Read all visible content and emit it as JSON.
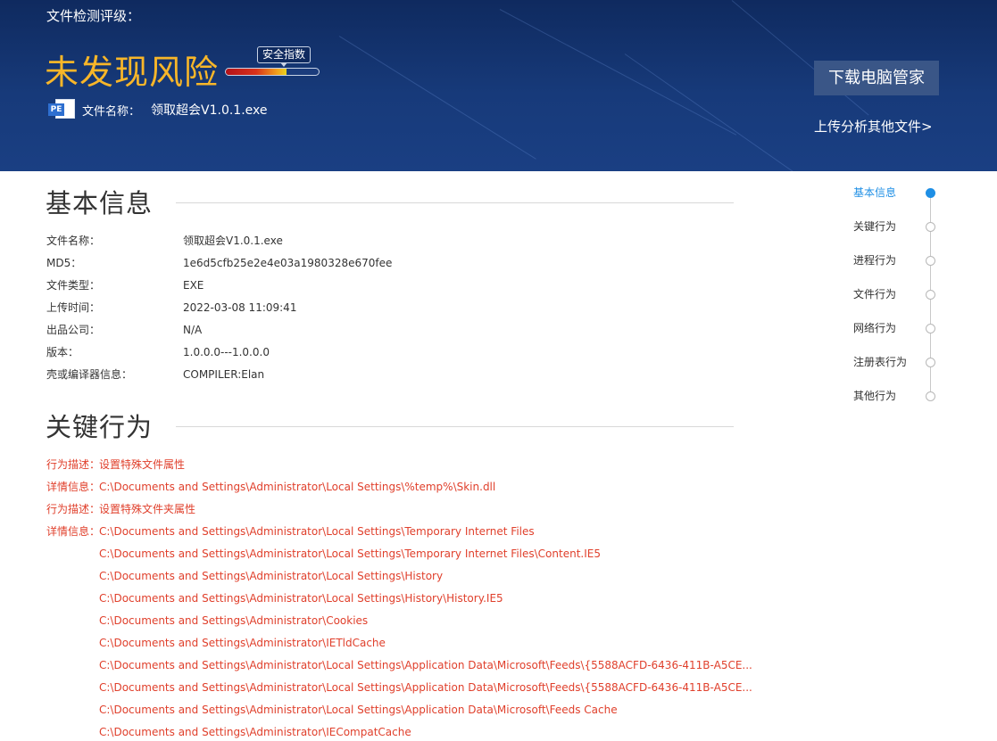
{
  "header": {
    "rating_title": "文件检测评级：",
    "risk_level": "未发现风险",
    "safety_index_label": "安全指数",
    "safety_index_level": 0.65,
    "file_icon_text": "PE",
    "file_name_label": "文件名称：",
    "file_name": "领取超会V1.0.1.exe",
    "download_button": "下载电脑管家",
    "upload_link": "上传分析其他文件>"
  },
  "basic_info": {
    "title": "基本信息",
    "rows": [
      {
        "key": "文件名称：",
        "value": "领取超会V1.0.1.exe"
      },
      {
        "key": "MD5：",
        "value": "1e6d5cfb25e2e4e03a1980328e670fee"
      },
      {
        "key": "文件类型：",
        "value": "EXE"
      },
      {
        "key": "上传时间：",
        "value": "2022-03-08 11:09:41"
      },
      {
        "key": "出品公司：",
        "value": "N/A"
      },
      {
        "key": "版本：",
        "value": "1.0.0.0---1.0.0.0"
      },
      {
        "key": "壳或编译器信息：",
        "value": "COMPILER:Elan"
      }
    ]
  },
  "key_behavior": {
    "title": "关键行为",
    "lines": [
      {
        "key": "行为描述：",
        "value": "设置特殊文件属性"
      },
      {
        "key": "详情信息：",
        "value": "C:\\Documents and Settings\\Administrator\\Local Settings\\%temp%\\Skin.dll"
      },
      {
        "key": "行为描述：",
        "value": "设置特殊文件夹属性"
      },
      {
        "key": "详情信息：",
        "value": "C:\\Documents and Settings\\Administrator\\Local Settings\\Temporary Internet Files"
      },
      {
        "key": "",
        "value": "C:\\Documents and Settings\\Administrator\\Local Settings\\Temporary Internet Files\\Content.IE5"
      },
      {
        "key": "",
        "value": "C:\\Documents and Settings\\Administrator\\Local Settings\\History"
      },
      {
        "key": "",
        "value": "C:\\Documents and Settings\\Administrator\\Local Settings\\History\\History.IE5"
      },
      {
        "key": "",
        "value": "C:\\Documents and Settings\\Administrator\\Cookies"
      },
      {
        "key": "",
        "value": "C:\\Documents and Settings\\Administrator\\IETldCache"
      },
      {
        "key": "",
        "value": "C:\\Documents and Settings\\Administrator\\Local Settings\\Application Data\\Microsoft\\Feeds\\{5588ACFD-6436-411B-A5CE..."
      },
      {
        "key": "",
        "value": "C:\\Documents and Settings\\Administrator\\Local Settings\\Application Data\\Microsoft\\Feeds\\{5588ACFD-6436-411B-A5CE..."
      },
      {
        "key": "",
        "value": "C:\\Documents and Settings\\Administrator\\Local Settings\\Application Data\\Microsoft\\Feeds Cache"
      },
      {
        "key": "",
        "value": "C:\\Documents and Settings\\Administrator\\IECompatCache"
      }
    ]
  },
  "side_nav": {
    "items": [
      {
        "label": "基本信息",
        "active": true
      },
      {
        "label": "关键行为",
        "active": false
      },
      {
        "label": "进程行为",
        "active": false
      },
      {
        "label": "文件行为",
        "active": false
      },
      {
        "label": "网络行为",
        "active": false
      },
      {
        "label": "注册表行为",
        "active": false
      },
      {
        "label": "其他行为",
        "active": false
      }
    ]
  },
  "colors": {
    "banner": "#173a7a",
    "risk_text": "#f8b629",
    "behavior_text": "#e0402c",
    "nav_active": "#1f8fe5"
  }
}
